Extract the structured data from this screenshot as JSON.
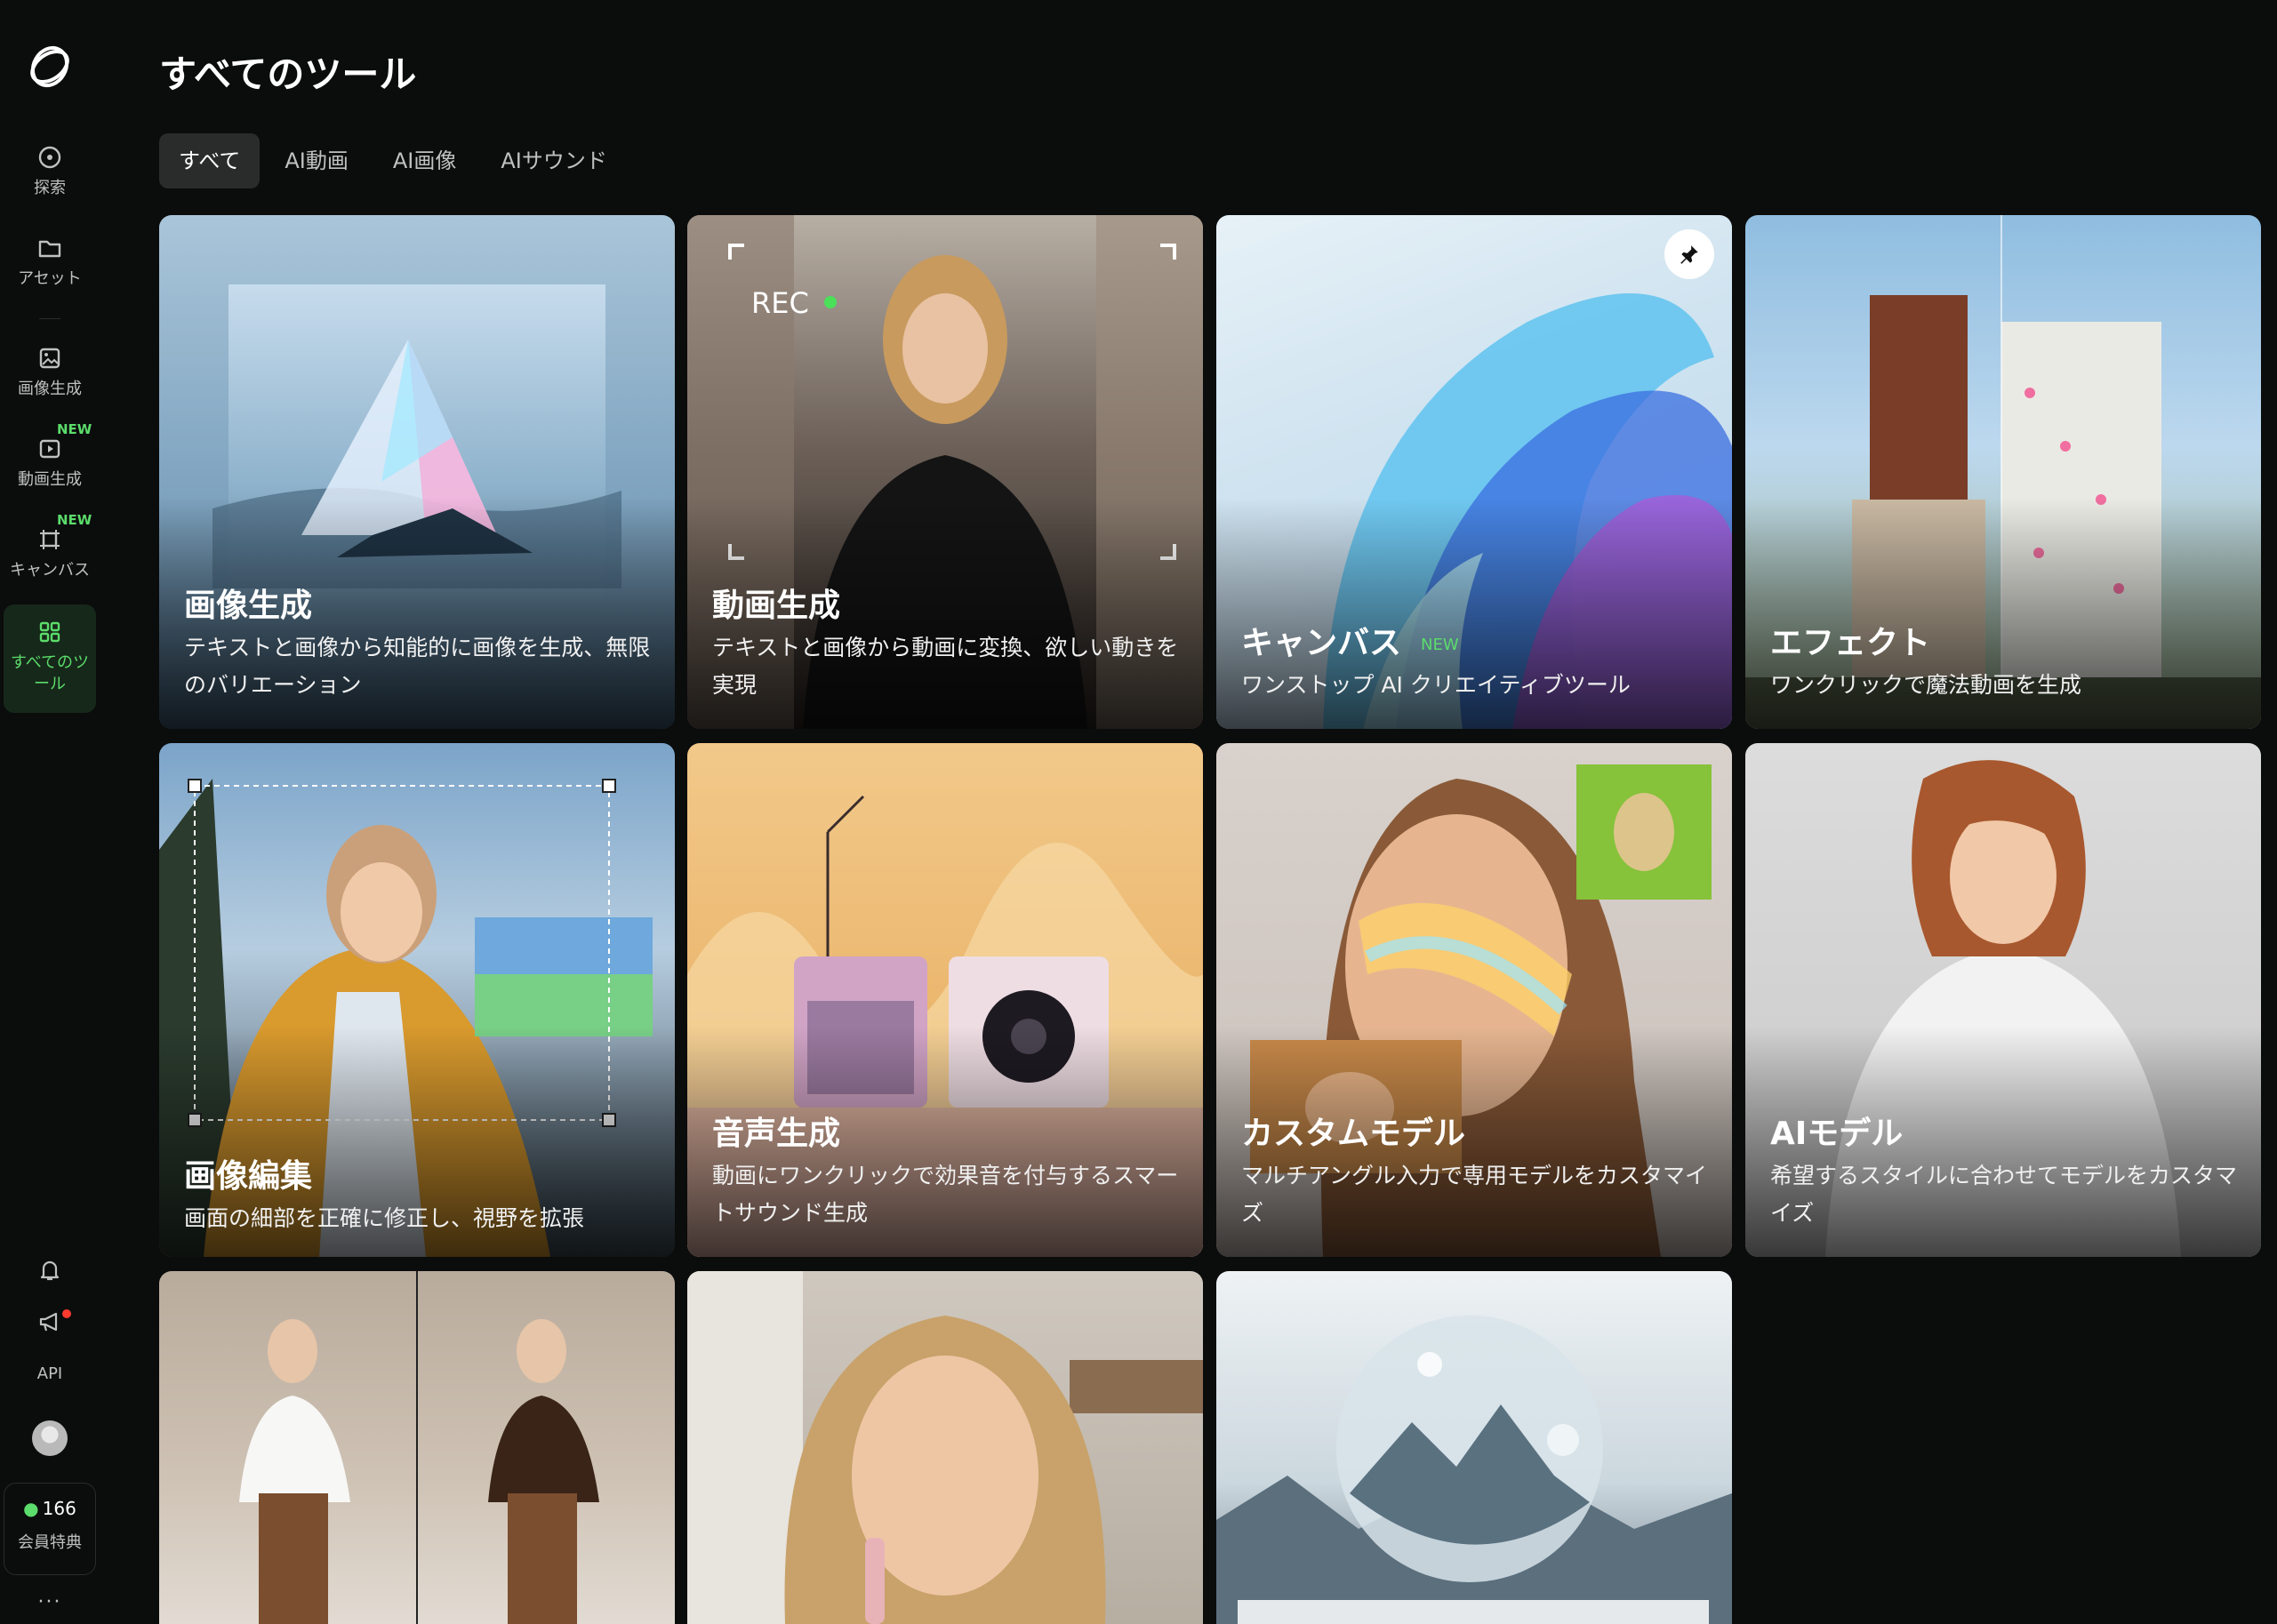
{
  "page": {
    "title": "すべてのツール"
  },
  "tabs": [
    {
      "label": "すべて",
      "active": true
    },
    {
      "label": "AI動画",
      "active": false
    },
    {
      "label": "AI画像",
      "active": false
    },
    {
      "label": "AIサウンド",
      "active": false
    }
  ],
  "sidebar": {
    "items": [
      {
        "label": "探索",
        "icon": "compass-icon"
      },
      {
        "label": "アセット",
        "icon": "folder-icon"
      },
      {
        "label": "画像生成",
        "icon": "image-icon"
      },
      {
        "label": "動画生成",
        "icon": "video-icon",
        "badge": "NEW"
      },
      {
        "label": "キャンバス",
        "icon": "canvas-icon",
        "badge": "NEW"
      },
      {
        "label": "すべてのツール",
        "icon": "grid-icon",
        "active": true
      }
    ],
    "api_label": "API",
    "credits": "166",
    "member_label": "会員特典",
    "more": "···"
  },
  "cards": [
    {
      "title": "画像生成",
      "desc": "テキストと画像から知能的に画像を生成、無限のバリエーション"
    },
    {
      "title": "動画生成",
      "desc": "テキストと画像から動画に変換、欲しい動きを実現",
      "rec_label": "REC"
    },
    {
      "title": "キャンバス",
      "badge": "NEW",
      "desc": "ワンストップ AI クリエイティブツール"
    },
    {
      "title": "エフェクト",
      "desc": "ワンクリックで魔法動画を生成"
    },
    {
      "title": "画像編集",
      "desc": "画面の細部を正確に修正し、視野を拡張"
    },
    {
      "title": "音声生成",
      "desc": "動画にワンクリックで効果音を付与するスマートサウンド生成"
    },
    {
      "title": "カスタムモデル",
      "desc": "マルチアングル入力で専用モデルをカスタマイズ"
    },
    {
      "title": "AIモデル",
      "desc": "希望するスタイルに合わせてモデルをカスタマイズ"
    }
  ],
  "colors": {
    "accent": "#5bdc6b",
    "background": "#0b0c0c",
    "tab_active": "#2a2c2c"
  }
}
